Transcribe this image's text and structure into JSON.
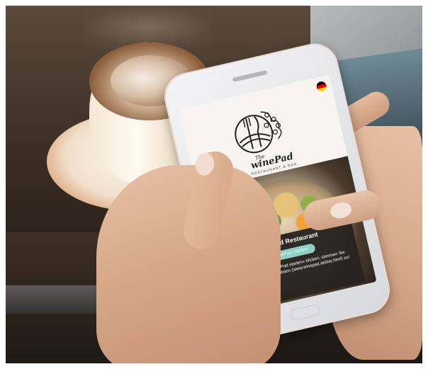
{
  "scene": {
    "description_colors": {
      "screen_bg": "#f7f4f1",
      "panel_bg": "#26221f",
      "button_bg": "#8fcfc8"
    }
  },
  "app": {
    "brand": {
      "the": "The",
      "name": "winePad",
      "tagline": "RESTAURANT & BAR"
    },
    "language_flag": "germany-flag-icon",
    "cookie_banner": {
      "title": "winePad Restaurant",
      "button_label": "winePad starten",
      "text": "Indem Sie auf »winePad starten« klicken, stimmen Sie unseren Cookie Richtlinien (www.winepad.at/dse.html) zu!"
    }
  }
}
